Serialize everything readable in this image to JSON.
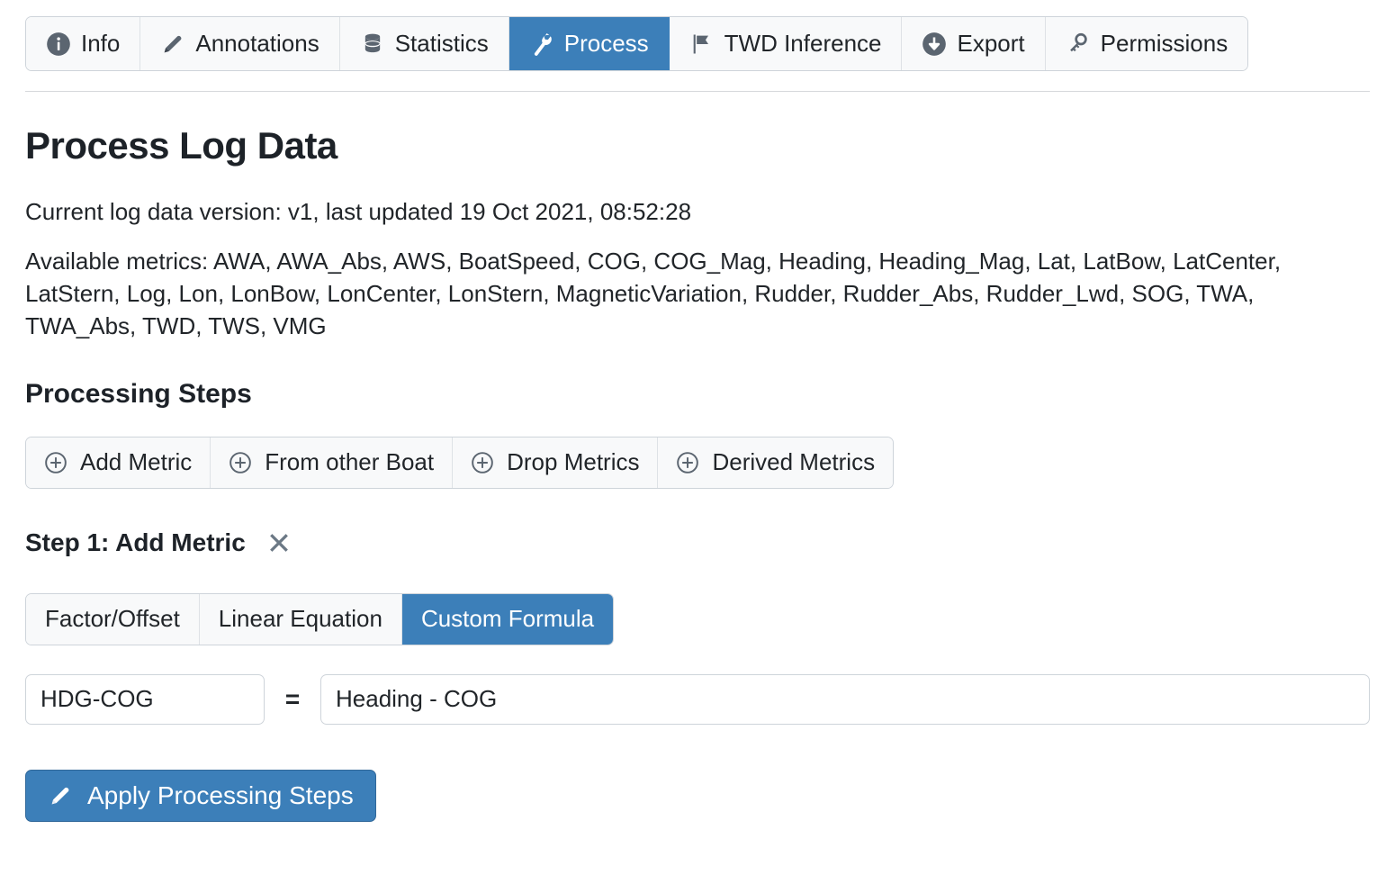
{
  "theme": {
    "accent": "#3c7fb9",
    "icon_gray": "#5b6570",
    "text": "#212529",
    "border": "#ced4da",
    "button_bg": "#f8f9fa"
  },
  "tabs": [
    {
      "label": "Info",
      "icon": "info-circle-icon",
      "active": false
    },
    {
      "label": "Annotations",
      "icon": "pencil-icon",
      "active": false
    },
    {
      "label": "Statistics",
      "icon": "database-icon",
      "active": false
    },
    {
      "label": "Process",
      "icon": "wrench-icon",
      "active": true
    },
    {
      "label": "TWD Inference",
      "icon": "flag-icon",
      "active": false
    },
    {
      "label": "Export",
      "icon": "download-circle-icon",
      "active": false
    },
    {
      "label": "Permissions",
      "icon": "key-icon",
      "active": false
    }
  ],
  "page": {
    "title": "Process Log Data",
    "version_line": "Current log data version: v1, last updated 19 Oct 2021, 08:52:28",
    "metrics_label": "Available metrics:",
    "metrics_list": "AWA, AWA_Abs, AWS, BoatSpeed, COG, COG_Mag, Heading, Heading_Mag, Lat, LatBow, LatCenter, LatStern, Log, Lon, LonBow, LonCenter, LonStern, MagneticVariation, Rudder, Rudder_Abs, Rudder_Lwd, SOG, TWA, TWA_Abs, TWD, TWS, VMG",
    "metrics_line": "Available metrics: AWA, AWA_Abs, AWS, BoatSpeed, COG, COG_Mag, Heading, Heading_Mag, Lat, LatBow, LatCenter, LatStern, Log, Lon, LonBow, LonCenter, LonStern, MagneticVariation, Rudder, Rudder_Abs, Rudder_Lwd, SOG, TWA, TWA_Abs, TWD, TWS, VMG",
    "section_title": "Processing Steps"
  },
  "add_buttons": [
    {
      "label": "Add Metric",
      "icon": "plus-circle-icon"
    },
    {
      "label": "From other Boat",
      "icon": "plus-circle-icon"
    },
    {
      "label": "Drop Metrics",
      "icon": "plus-circle-icon"
    },
    {
      "label": "Derived Metrics",
      "icon": "plus-circle-icon"
    }
  ],
  "step": {
    "title": "Step 1: Add Metric",
    "remove_icon": "close-x-icon",
    "modes": [
      {
        "label": "Factor/Offset",
        "active": false
      },
      {
        "label": "Linear Equation",
        "active": false
      },
      {
        "label": "Custom Formula",
        "active": true
      }
    ],
    "metric_name": {
      "value": "HDG-COG",
      "placeholder": "Metric name"
    },
    "equals_symbol": "=",
    "formula": {
      "value": "Heading - COG",
      "placeholder": "Formula"
    }
  },
  "apply": {
    "label": "Apply Processing Steps",
    "icon": "pencil-icon"
  }
}
